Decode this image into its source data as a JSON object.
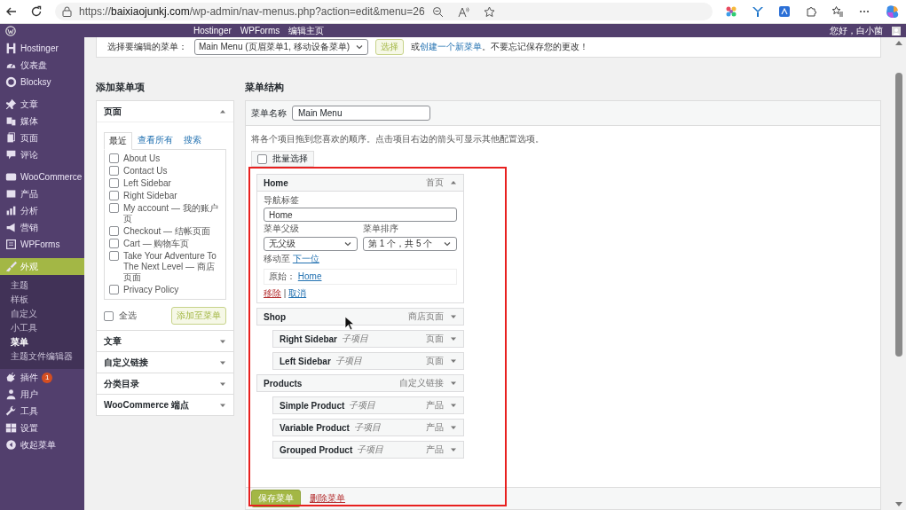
{
  "browser": {
    "url": "https://**baixiaojunkj.com**/wp-admin/nav-menus.php?action=edit&menu=26"
  },
  "admin_bar": {
    "items": [
      "Hostinger",
      "WPForms",
      "编辑主页"
    ],
    "greeting": "您好，白小菌"
  },
  "sidebar": {
    "groups": [
      [
        {
          "label": "Hostinger",
          "selected": false
        },
        {
          "label": "仪表盘",
          "selected": false
        },
        {
          "label": "Blocksy",
          "selected": false
        }
      ],
      [
        {
          "label": "文章",
          "selected": false
        },
        {
          "label": "媒体",
          "selected": false
        },
        {
          "label": "页面",
          "selected": false
        },
        {
          "label": "评论",
          "selected": false
        }
      ],
      [
        {
          "label": "WooCommerce",
          "selected": false
        },
        {
          "label": "产品",
          "selected": false
        },
        {
          "label": "分析",
          "selected": false
        },
        {
          "label": "营销",
          "selected": false
        },
        {
          "label": "WPForms",
          "selected": false
        }
      ],
      [
        {
          "label": "外观",
          "selected": true,
          "children": [
            {
              "label": "主题",
              "selected": false
            },
            {
              "label": "样板",
              "selected": false
            },
            {
              "label": "自定义",
              "selected": false
            },
            {
              "label": "小工具",
              "selected": false
            },
            {
              "label": "菜单",
              "selected": true
            },
            {
              "label": "主题文件编辑器",
              "selected": false
            }
          ]
        },
        {
          "label": "插件",
          "selected": false,
          "badge": "1"
        },
        {
          "label": "用户",
          "selected": false
        },
        {
          "label": "工具",
          "selected": false
        },
        {
          "label": "设置",
          "selected": false
        },
        {
          "label": "收起菜单",
          "selected": false
        }
      ]
    ]
  },
  "select_bar": {
    "label": "选择要编辑的菜单：",
    "value": "Main Menu (页眉菜单1, 移动设备菜单)",
    "button": "选择",
    "note_before": "或",
    "link": "创建一个新菜单",
    "note_after": "。不要忘记保存您的更改！"
  },
  "add_items": {
    "title": "添加菜单项",
    "sections": [
      {
        "title": "页面",
        "expanded": true,
        "tabs": [
          {
            "label": "最近",
            "selected": true
          },
          {
            "label": "查看所有",
            "selected": false
          },
          {
            "label": "搜索",
            "selected": false
          }
        ],
        "items": [
          {
            "label": "About Us",
            "checked": false
          },
          {
            "label": "Contact Us",
            "checked": false
          },
          {
            "label": "Left Sidebar",
            "checked": false
          },
          {
            "label": "Right Sidebar",
            "checked": false
          },
          {
            "label": "My account — 我的账户页",
            "checked": false
          },
          {
            "label": "Checkout — 结帐页面",
            "checked": false
          },
          {
            "label": "Cart — 购物车页",
            "checked": false
          },
          {
            "label": "Take Your Adventure To The Next Level — 商店页面",
            "checked": false
          },
          {
            "label": "Privacy Policy",
            "checked": false
          }
        ],
        "select_all": {
          "label": "全选",
          "checked": false
        },
        "button": "添加至菜单"
      },
      {
        "title": "文章",
        "expanded": false
      },
      {
        "title": "自定义链接",
        "expanded": false
      },
      {
        "title": "分类目录",
        "expanded": false
      },
      {
        "title": "WooCommerce 端点",
        "expanded": false
      }
    ]
  },
  "structure": {
    "title": "菜单结构",
    "name_label": "菜单名称",
    "name_value": "Main Menu",
    "instructions": "将各个项目拖到您喜欢的顺序。点击项目右边的箭头可显示其他配置选项。",
    "bulk": {
      "label": "批量选择",
      "checked": false
    },
    "items": [
      {
        "title": "Home",
        "type": "首页",
        "expanded": true,
        "settings": {
          "nav_label": "导航标签",
          "nav_value": "Home",
          "parent_label": "菜单父级",
          "parent_value": "无父级",
          "order_label": "菜单排序",
          "order_value": "第 1 个，共 5 个",
          "move_label": "移动至",
          "move_link": "下一位",
          "original_label": "原始：",
          "original_link": "Home",
          "remove": "移除",
          "separator": "|",
          "cancel": "取消"
        }
      },
      {
        "title": "Shop",
        "type": "商店页面",
        "expanded": false,
        "children": [
          {
            "title": "Right Sidebar",
            "sub": "子项目",
            "type": "页面",
            "expanded": false
          },
          {
            "title": "Left Sidebar",
            "sub": "子项目",
            "type": "页面",
            "expanded": false
          }
        ]
      },
      {
        "title": "Products",
        "type": "自定义链接",
        "expanded": false,
        "children": [
          {
            "title": "Simple Product",
            "sub": "子项目",
            "type": "产品",
            "expanded": false
          },
          {
            "title": "Variable Product",
            "sub": "子项目",
            "type": "产品",
            "expanded": false
          },
          {
            "title": "Grouped Product",
            "sub": "子项目",
            "type": "产品",
            "expanded": false
          }
        ]
      }
    ],
    "save": "保存菜单",
    "delete": "删除菜单"
  }
}
